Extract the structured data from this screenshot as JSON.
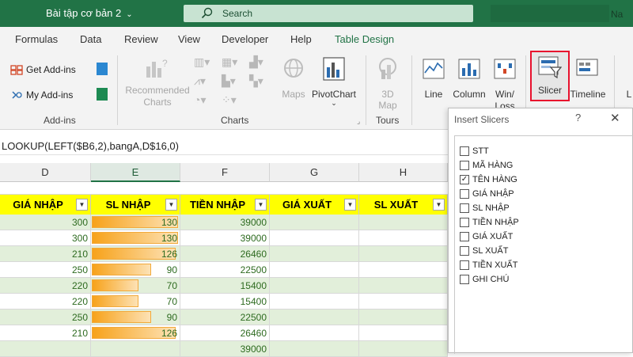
{
  "window": {
    "doc_title": "Bài tập cơ bản 2",
    "search_placeholder": "Search",
    "user_initial": "Na"
  },
  "menu": [
    "Formulas",
    "Data",
    "Review",
    "View",
    "Developer",
    "Help",
    "Table Design"
  ],
  "ribbon": {
    "addins": {
      "get_addins": "Get Add-ins",
      "my_addins": "My Add-ins",
      "group_label": "Add-ins"
    },
    "charts": {
      "recommended": [
        "Recommended",
        "Charts"
      ],
      "maps": "Maps",
      "pivotchart": "PivotChart",
      "group_label": "Charts"
    },
    "tours": {
      "map3d": [
        "3D",
        "Map"
      ],
      "group_label": "Tours"
    },
    "sparklines": {
      "line": "Line",
      "column": "Column",
      "winloss": [
        "Win/",
        "Loss"
      ]
    },
    "filters": {
      "slicer": "Slicer",
      "timeline": "Timeline",
      "more": "L"
    }
  },
  "formula_bar": {
    "text": "LOOKUP(LEFT($B6,2),bangA,D$16,0)"
  },
  "grid": {
    "columns": [
      "D",
      "E",
      "F",
      "G",
      "H"
    ],
    "headers": [
      "GIÁ NHẬP",
      "SL NHẬP",
      "TIỀN NHẬP",
      "GIÁ XUẤT",
      "SL XUẤT"
    ],
    "rows": [
      {
        "gia_nhap": "300",
        "sl_nhap": "130",
        "sl_fill": 1.0,
        "tien_nhap": "39000"
      },
      {
        "gia_nhap": "300",
        "sl_nhap": "130",
        "sl_fill": 1.0,
        "tien_nhap": "39000"
      },
      {
        "gia_nhap": "210",
        "sl_nhap": "126",
        "sl_fill": 0.97,
        "tien_nhap": "26460"
      },
      {
        "gia_nhap": "250",
        "sl_nhap": "90",
        "sl_fill": 0.69,
        "tien_nhap": "22500"
      },
      {
        "gia_nhap": "220",
        "sl_nhap": "70",
        "sl_fill": 0.54,
        "tien_nhap": "15400"
      },
      {
        "gia_nhap": "220",
        "sl_nhap": "70",
        "sl_fill": 0.54,
        "tien_nhap": "15400"
      },
      {
        "gia_nhap": "250",
        "sl_nhap": "90",
        "sl_fill": 0.69,
        "tien_nhap": "22500"
      },
      {
        "gia_nhap": "210",
        "sl_nhap": "126",
        "sl_fill": 0.97,
        "tien_nhap": "26460"
      },
      {
        "gia_nhap": "",
        "sl_nhap": "",
        "sl_fill": 0,
        "tien_nhap": "39000"
      }
    ]
  },
  "insert_slicers": {
    "title": "Insert Slicers",
    "help": "?",
    "close": "✕",
    "fields": [
      {
        "label": "STT",
        "checked": false
      },
      {
        "label": "MÃ HÀNG",
        "checked": false
      },
      {
        "label": "TÊN HÀNG",
        "checked": true
      },
      {
        "label": "GIÁ NHẬP",
        "checked": false
      },
      {
        "label": "SL NHẬP",
        "checked": false
      },
      {
        "label": "TIỀN NHẬP",
        "checked": false
      },
      {
        "label": "GIÁ XUẤT",
        "checked": false
      },
      {
        "label": "SL XUẤT",
        "checked": false
      },
      {
        "label": "TIỀN XUẤT",
        "checked": false
      },
      {
        "label": "GHI CHÚ",
        "checked": false
      }
    ]
  },
  "colors": {
    "excel_green": "#217346",
    "header_yellow": "#ffff00",
    "band_green": "#e2efda",
    "databar_orange": "#f7a21a",
    "highlight_red": "#e8112d"
  }
}
